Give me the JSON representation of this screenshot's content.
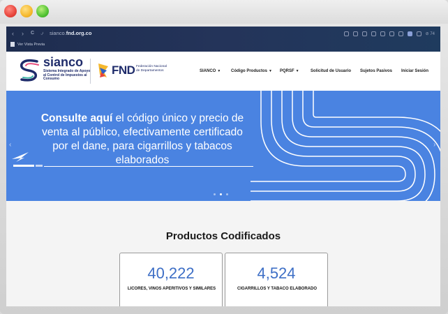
{
  "browser": {
    "nav": {
      "back": "‹",
      "forward": "›",
      "reload": "C"
    },
    "url_prefix": "sianco.",
    "url_domain": "fnd.org.co",
    "bookmark_label": "Ver Vista Previa",
    "ext_text": "⊘ 74"
  },
  "header": {
    "logo_name": "sianco",
    "logo_subtitle": "Sistema Integrado de Apoyo al Control de Impuestos al Consumo",
    "fnd_text": "FND",
    "fnd_subtitle": "Federación Nacional de Departamentos",
    "menu": [
      {
        "label": "SIANCO",
        "caret": "▼"
      },
      {
        "label": "Código Productos",
        "caret": "▼"
      },
      {
        "label": "PQRSF",
        "caret": "▼"
      },
      {
        "label": "Solicitud de Usuario",
        "caret": ""
      },
      {
        "label": "Sujetos Pasivos",
        "caret": ""
      },
      {
        "label": "Iniciar Sesión",
        "caret": ""
      }
    ]
  },
  "hero": {
    "strong": "Consulte aquí",
    "text": " el código único y precio de venta al público, efectivamente certificado por el dane, para cigarrillos y tabacos elaborados",
    "prev": "‹",
    "next": "›"
  },
  "products": {
    "title": "Productos Codificados",
    "cards": [
      {
        "count": "40,222",
        "label": "LICORES, VINOS APERITIVOS Y SIMILARES"
      },
      {
        "count": "4,524",
        "label": "CIGARRILLOS Y TABACO ELABORADO"
      }
    ]
  },
  "colors": {
    "hero_bg": "#4a83e1",
    "brand_navy": "#1f2c6b",
    "count_blue": "#3e6fc6"
  }
}
